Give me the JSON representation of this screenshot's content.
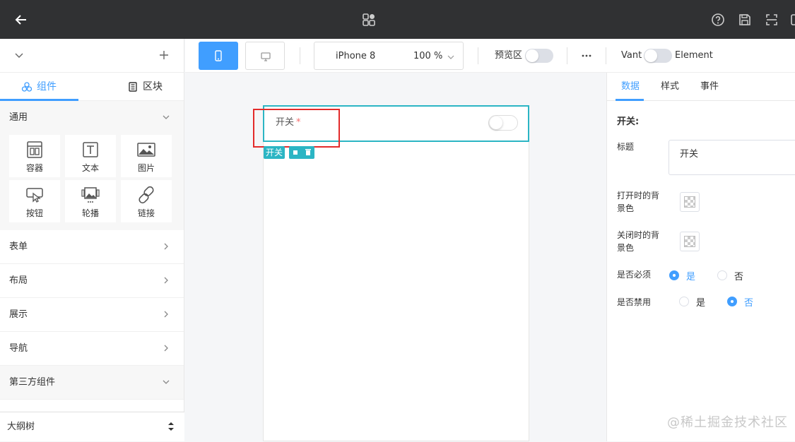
{
  "left_panel": {
    "tabs": [
      {
        "label": "组件",
        "icon": "components-icon"
      },
      {
        "label": "区块",
        "icon": "document-icon"
      }
    ],
    "groups": {
      "general": "通用",
      "form": "表单",
      "layout": "布局",
      "display": "展示",
      "nav": "导航",
      "third_party": "第三方组件"
    },
    "components": [
      {
        "label": "容器",
        "icon": "container-icon"
      },
      {
        "label": "文本",
        "icon": "text-icon"
      },
      {
        "label": "图片",
        "icon": "image-icon"
      },
      {
        "label": "按钮",
        "icon": "button-icon"
      },
      {
        "label": "轮播",
        "icon": "carousel-icon"
      },
      {
        "label": "链接",
        "icon": "link-icon"
      }
    ],
    "outline": "大纲树"
  },
  "toolbar": {
    "device_name": "iPhone 8",
    "zoom": "100 %",
    "preview_label": "预览区",
    "vant_label": "Vant",
    "element_label": "Element"
  },
  "canvas": {
    "field_label": "开关",
    "required_mark": "*",
    "tag_label": "开关"
  },
  "right_panel": {
    "tabs": [
      "数据",
      "样式",
      "事件"
    ],
    "section_title": "开关:",
    "title_label": "标题",
    "title_value": "开关",
    "open_bg_label": "打开时的背景色",
    "close_bg_label": "关闭时的背景色",
    "required_label": "是否必须",
    "disabled_label": "是否禁用",
    "yes": "是",
    "no": "否"
  },
  "watermark": "@稀土掘金技术社区",
  "colors": {
    "accent": "#409eff",
    "selection": "#2bb5c4",
    "highlight": "#e32b2b",
    "topbar": "#303133"
  }
}
